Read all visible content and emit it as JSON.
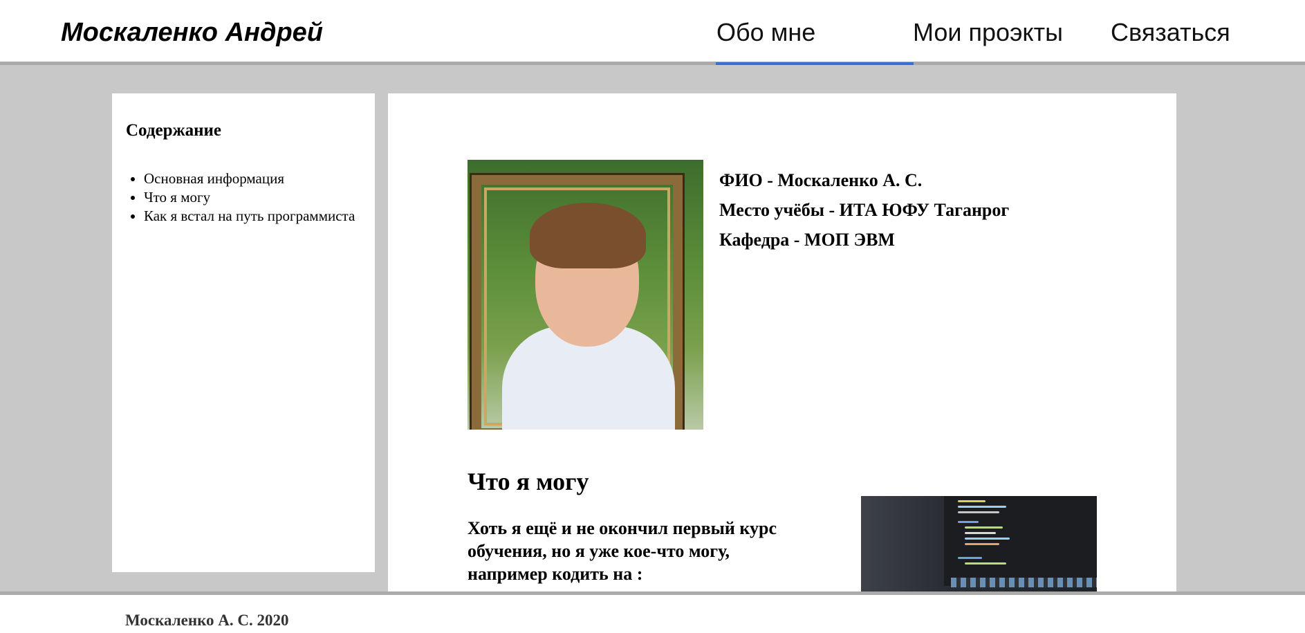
{
  "header": {
    "logo": "Москаленко Андрей",
    "nav": [
      {
        "label": "Обо мне",
        "active": true
      },
      {
        "label": "Мои проэкты",
        "active": false
      },
      {
        "label": "Связаться",
        "active": false
      }
    ],
    "accent_color": "#3a6fd8"
  },
  "sidebar": {
    "title": "Содержание",
    "items": [
      {
        "label": "Основная информация"
      },
      {
        "label": "Что я могу"
      },
      {
        "label": "Как я встал на путь программиста"
      }
    ]
  },
  "main": {
    "photo_icon": "portrait-photo",
    "info": [
      "ФИО - Москаленко А. С.",
      "Место учёбы - ИТА ЮФУ Таганрог",
      "Кафедра - МОП ЭВМ"
    ],
    "section_title": "Что я могу",
    "section_text": "Хоть я ещё и не окончил первый курс обучения, но я уже кое-что могу, например кодить на :",
    "code_image_icon": "code-editor-photo"
  },
  "footer": {
    "text": "Москаленко А. С. 2020"
  },
  "colors": {
    "background": "#c8c8c8",
    "panel": "#ffffff",
    "divider": "#aaaaaa"
  }
}
